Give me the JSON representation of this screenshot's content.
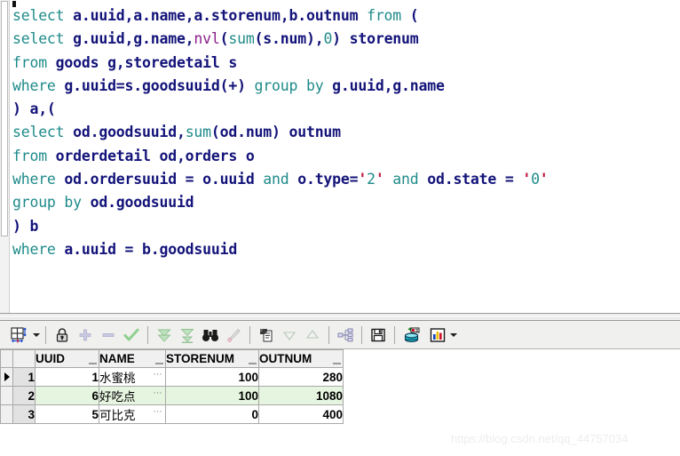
{
  "editor": {
    "lines": [
      [
        {
          "t": "select ",
          "c": "kw"
        },
        {
          "t": "a.uuid,a.name,a.storenum,b.outnum",
          "c": "id"
        },
        {
          "t": " from ",
          "c": "kw"
        },
        {
          "t": "(",
          "c": "punc"
        }
      ],
      [
        {
          "t": "select ",
          "c": "kw"
        },
        {
          "t": "g.uuid,g.name,",
          "c": "id"
        },
        {
          "t": "nvl",
          "c": "fn"
        },
        {
          "t": "(",
          "c": "punc"
        },
        {
          "t": "sum",
          "c": "kw"
        },
        {
          "t": "(",
          "c": "punc"
        },
        {
          "t": "s.num",
          "c": "id"
        },
        {
          "t": "),",
          "c": "punc"
        },
        {
          "t": "0",
          "c": "num"
        },
        {
          "t": ") ",
          "c": "punc"
        },
        {
          "t": "storenum",
          "c": "id"
        }
      ],
      [
        {
          "t": "from ",
          "c": "kw"
        },
        {
          "t": "goods g,storedetail s",
          "c": "id"
        }
      ],
      [
        {
          "t": "where ",
          "c": "kw"
        },
        {
          "t": "g.uuid=s.goodsuuid",
          "c": "id"
        },
        {
          "t": "(+)",
          "c": "punc"
        },
        {
          "t": " group by ",
          "c": "kw"
        },
        {
          "t": "g.uuid,g.name",
          "c": "id"
        }
      ],
      [
        {
          "t": ")",
          "c": "punc"
        },
        {
          "t": " a,(",
          "c": "id"
        }
      ],
      [
        {
          "t": "select ",
          "c": "kw"
        },
        {
          "t": "od.goodsuuid,",
          "c": "id"
        },
        {
          "t": "sum",
          "c": "kw"
        },
        {
          "t": "(",
          "c": "punc"
        },
        {
          "t": "od.num",
          "c": "id"
        },
        {
          "t": ") ",
          "c": "punc"
        },
        {
          "t": "outnum",
          "c": "id"
        }
      ],
      [
        {
          "t": "from ",
          "c": "kw"
        },
        {
          "t": "orderdetail od,orders o",
          "c": "id"
        }
      ],
      [
        {
          "t": "where ",
          "c": "kw"
        },
        {
          "t": "od.ordersuuid = o.uuid",
          "c": "id"
        },
        {
          "t": " and ",
          "c": "kw"
        },
        {
          "t": "o.type=",
          "c": "id"
        },
        {
          "t": "'",
          "c": "q"
        },
        {
          "t": "2",
          "c": "str"
        },
        {
          "t": "'",
          "c": "q"
        },
        {
          "t": " and ",
          "c": "kw"
        },
        {
          "t": "od.state = ",
          "c": "id"
        },
        {
          "t": "'",
          "c": "q"
        },
        {
          "t": "0",
          "c": "str"
        },
        {
          "t": "'",
          "c": "q"
        }
      ],
      [
        {
          "t": "group by ",
          "c": "kw"
        },
        {
          "t": "od.goodsuuid",
          "c": "id"
        }
      ],
      [
        {
          "t": ")",
          "c": "punc"
        },
        {
          "t": " b",
          "c": "id"
        }
      ],
      [
        {
          "t": "where ",
          "c": "kw"
        },
        {
          "t": "a.uuid = b.goodsuuid",
          "c": "id"
        }
      ]
    ],
    "colors": {
      "keyword": "#1f8a8a",
      "identifier": "#13137a",
      "function": "#8a1f8a",
      "quote": "#c01038"
    }
  },
  "toolbar": {
    "items": [
      {
        "name": "grid-layout-icon",
        "tip": "Grid layout"
      },
      {
        "name": "grid-layout-dropdown-icon",
        "tip": "Grid layout options"
      },
      {
        "name": "lock-icon",
        "tip": "Lock / Read only"
      },
      {
        "name": "add-row-icon",
        "tip": "Insert row"
      },
      {
        "name": "remove-row-icon",
        "tip": "Delete row"
      },
      {
        "name": "commit-check-icon",
        "tip": "Post changes"
      },
      {
        "name": "fetch-next-page-icon",
        "tip": "Fetch next page"
      },
      {
        "name": "fetch-last-page-icon",
        "tip": "Fetch last page"
      },
      {
        "name": "find-binoculars-icon",
        "tip": "Find"
      },
      {
        "name": "highlight-pen-icon",
        "tip": "Highlight"
      },
      {
        "name": "copy-to-clipboard-icon",
        "tip": "Copy to clipboard"
      },
      {
        "name": "sort-descending-icon",
        "tip": "Sort descending"
      },
      {
        "name": "sort-ascending-icon",
        "tip": "Sort ascending"
      },
      {
        "name": "hierarchy-icon",
        "tip": "Record view"
      },
      {
        "name": "save-floppy-icon",
        "tip": "Export results"
      },
      {
        "name": "database-export-icon",
        "tip": "Export to database"
      },
      {
        "name": "bar-chart-icon",
        "tip": "Chart"
      },
      {
        "name": "bar-chart-dropdown-icon",
        "tip": "Chart options"
      }
    ]
  },
  "grid": {
    "columns": [
      "UUID",
      "NAME",
      "STORENUM",
      "OUTNUM"
    ],
    "rows": [
      {
        "index": "1",
        "selected": true,
        "UUID": "1",
        "NAME": "水蜜桃",
        "STORENUM": "100",
        "OUTNUM": "280"
      },
      {
        "index": "2",
        "selected": false,
        "UUID": "6",
        "NAME": "好吃点",
        "STORENUM": "100",
        "OUTNUM": "1080"
      },
      {
        "index": "3",
        "selected": false,
        "UUID": "5",
        "NAME": "可比克",
        "STORENUM": "0",
        "OUTNUM": "400"
      }
    ],
    "cell_overflow_marker": "⋯",
    "alt_row_color": "#e6f5e0"
  },
  "watermark": {
    "text": "https://blog.csdn.net/qq_44757034"
  }
}
